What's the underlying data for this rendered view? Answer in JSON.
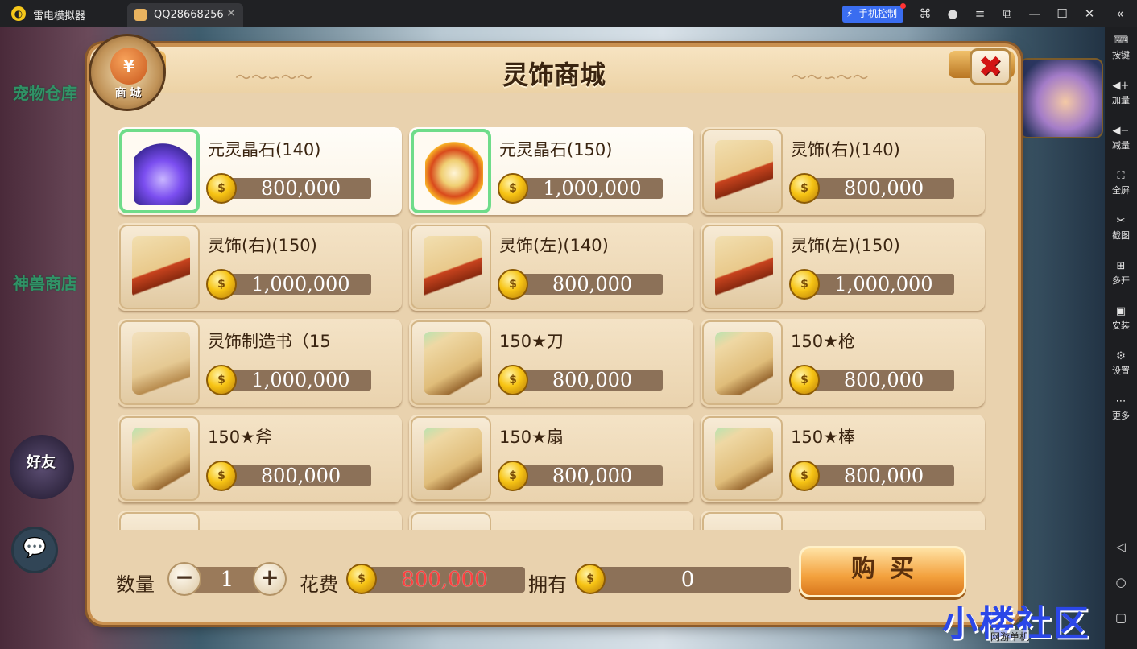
{
  "emulator": {
    "app_name": "雷电模拟器",
    "tab_title": "QQ28668256",
    "phone_control": "手机控制",
    "sidebar": [
      {
        "label": "按键",
        "icon": "keyboard-icon"
      },
      {
        "label": "加量",
        "icon": "volume-up-icon"
      },
      {
        "label": "减量",
        "icon": "volume-down-icon"
      },
      {
        "label": "全屏",
        "icon": "fullscreen-icon"
      },
      {
        "label": "截图",
        "icon": "scissors-icon"
      },
      {
        "label": "多开",
        "icon": "multi-instance-icon"
      },
      {
        "label": "安装",
        "icon": "apk-install-icon"
      },
      {
        "label": "设置",
        "icon": "gear-icon"
      },
      {
        "label": "更多",
        "icon": "more-icon"
      }
    ]
  },
  "background": {
    "left_texts": [
      "宠物仓库",
      "神兽商店",
      "好友"
    ]
  },
  "shop": {
    "badge_label": "商 城",
    "title": "灵饰商城",
    "items": [
      {
        "name": "元灵晶石(140)",
        "price": "800,000",
        "icon": "crystal-icon",
        "selected": true
      },
      {
        "name": "元灵晶石(150)",
        "price": "1,000,000",
        "icon": "drum-icon",
        "selected": true
      },
      {
        "name": "灵饰(右)(140)",
        "price": "800,000",
        "icon": "red-scroll-icon",
        "selected": false
      },
      {
        "name": "灵饰(右)(150)",
        "price": "1,000,000",
        "icon": "red-scroll-icon",
        "selected": false
      },
      {
        "name": "灵饰(左)(140)",
        "price": "800,000",
        "icon": "red-scroll-icon",
        "selected": false
      },
      {
        "name": "灵饰(左)(150)",
        "price": "1,000,000",
        "icon": "red-scroll-icon",
        "selected": false
      },
      {
        "name": "灵饰制造书（15",
        "price": "1,000,000",
        "icon": "old-scroll-icon",
        "selected": false
      },
      {
        "name": "150★刀",
        "price": "800,000",
        "icon": "map-scroll-icon",
        "selected": false
      },
      {
        "name": "150★枪",
        "price": "800,000",
        "icon": "map-scroll-icon",
        "selected": false
      },
      {
        "name": "150★斧",
        "price": "800,000",
        "icon": "map-scroll-icon",
        "selected": false
      },
      {
        "name": "150★扇",
        "price": "800,000",
        "icon": "map-scroll-icon",
        "selected": false
      },
      {
        "name": "150★棒",
        "price": "800,000",
        "icon": "map-scroll-icon",
        "selected": false
      }
    ],
    "quantity_label": "数量",
    "quantity": "1",
    "cost_label": "花费",
    "cost": "800,000",
    "owned_label": "拥有",
    "owned": "0",
    "buy_label": "购买"
  },
  "watermark": {
    "text": "小楼社区",
    "sub": "网游单机"
  },
  "colors": {
    "panel_bg": "#e9d2ae",
    "price_bar": "#8c7158",
    "cost_text": "#ff4040",
    "selected_border": "#6fdc8a",
    "close_x": "#d31414"
  }
}
